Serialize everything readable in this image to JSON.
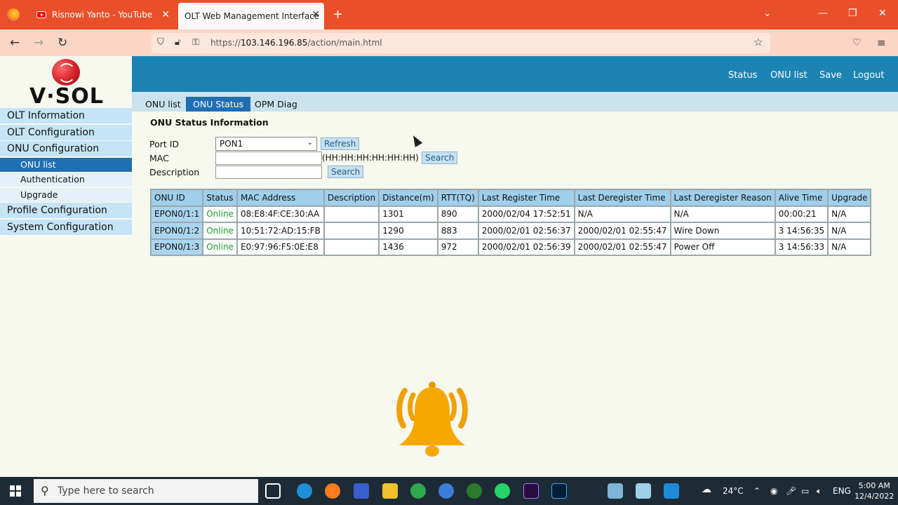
{
  "browser": {
    "tabs": [
      {
        "title": "Risnowi Yanto - YouTube"
      },
      {
        "title": "OLT Web Management Interface"
      }
    ],
    "url_prefix": "https://",
    "url_host": "103.146.196.85",
    "url_path": "/action/main.html"
  },
  "brand": {
    "logo_text": "V·SOL"
  },
  "header": {
    "links": [
      "Status",
      "ONU list",
      "Save",
      "Logout"
    ]
  },
  "sidebar": {
    "items": [
      {
        "label": "OLT Information"
      },
      {
        "label": "OLT Configuration"
      },
      {
        "label": "ONU Configuration"
      },
      {
        "label": "ONU list",
        "sub": true,
        "active": true
      },
      {
        "label": "Authentication",
        "sub": true
      },
      {
        "label": "Upgrade",
        "sub": true
      },
      {
        "label": "Profile Configuration"
      },
      {
        "label": "System Configuration"
      }
    ]
  },
  "subtabs": [
    {
      "label": "ONU list"
    },
    {
      "label": "ONU Status",
      "active": true
    },
    {
      "label": "OPM Diag"
    }
  ],
  "form": {
    "section_title": "ONU Status Information",
    "port_label": "Port ID",
    "port_value": "PON1",
    "refresh_label": "Refresh",
    "mac_label": "MAC",
    "mac_hint": "(HH:HH:HH:HH:HH:HH)",
    "search_label": "Search",
    "desc_label": "Description"
  },
  "table": {
    "columns": [
      "ONU ID",
      "Status",
      "MAC Address",
      "Description",
      "Distance(m)",
      "RTT(TQ)",
      "Last Register Time",
      "Last Deregister Time",
      "Last Deregister Reason",
      "Alive Time",
      "Upgrade"
    ],
    "rows": [
      [
        "EPON0/1:1",
        "Online",
        "08:E8:4F:CE:30:AA",
        "",
        "1301",
        "890",
        "2000/02/04 17:52:51",
        "N/A",
        "N/A",
        "00:00:21",
        "N/A"
      ],
      [
        "EPON0/1:2",
        "Online",
        "10:51:72:AD:15:FB",
        "",
        "1290",
        "883",
        "2000/02/01 02:56:37",
        "2000/02/01 02:55:47",
        "Wire Down",
        "3 14:56:35",
        "N/A"
      ],
      [
        "EPON0/1:3",
        "Online",
        "E0:97:96:F5:0E:E8",
        "",
        "1436",
        "972",
        "2000/02/01 02:56:39",
        "2000/02/01 02:55:47",
        "Power Off",
        "3 14:56:33",
        "N/A"
      ]
    ]
  },
  "taskbar": {
    "search_placeholder": "Type here to search",
    "temperature": "24°C",
    "language": "ENG",
    "time": "5:00 AM",
    "date": "12/4/2022"
  },
  "colors": {
    "tabstrip": "#e9502a",
    "header": "#1b84b4",
    "active_item": "#1f6fb2",
    "online": "#1aa32a"
  }
}
